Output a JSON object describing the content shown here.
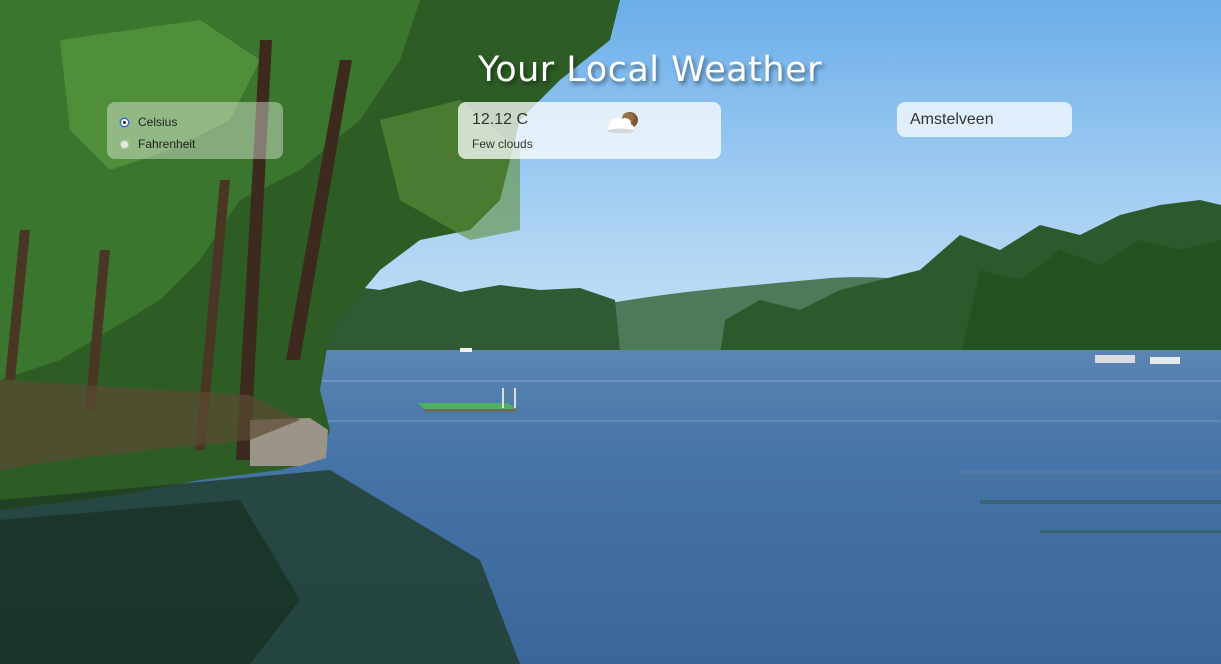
{
  "page": {
    "title": "Your Local Weather"
  },
  "units": {
    "options": [
      {
        "label": "Celsius",
        "checked": true
      },
      {
        "label": "Fahrenheit",
        "checked": false
      }
    ]
  },
  "weather": {
    "temperature": "12.12 C",
    "description": "Few clouds",
    "icon": "few-clouds-icon"
  },
  "location": {
    "city": "Amstelveen"
  },
  "background": {
    "scene": "lake-landscape",
    "sky_color": "#8ec2ef",
    "water_color": "#3f6f9f"
  }
}
